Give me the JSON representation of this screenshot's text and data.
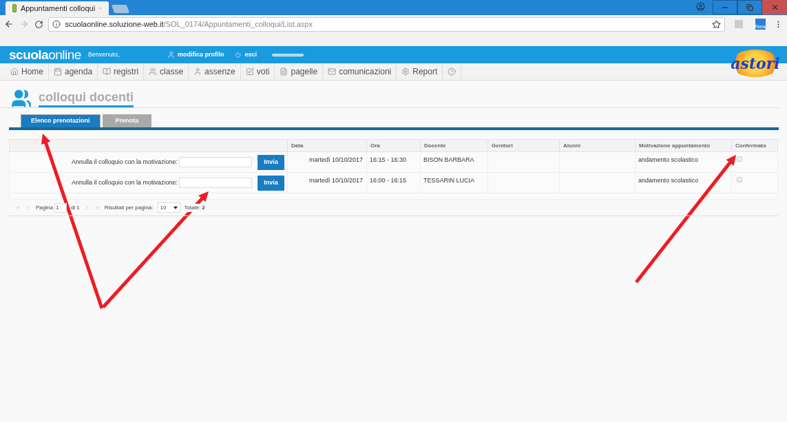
{
  "browser": {
    "tab_title": "Appuntamenti colloqui",
    "url_domain": "scuolaonline.soluzione-web.it",
    "url_path": "/SOL_0174/Appuntamenti_colloqui/List.aspx",
    "extension_badge": "New"
  },
  "header": {
    "brand_bold": "scuola",
    "brand_light": "online",
    "welcome": "Benvenuto,",
    "profile_link": "modifica profilo",
    "logout_link": "esci",
    "partner_logo": "astori"
  },
  "nav": [
    {
      "label": "Home"
    },
    {
      "label": "agenda"
    },
    {
      "label": "registri"
    },
    {
      "label": "classe"
    },
    {
      "label": "assenze"
    },
    {
      "label": "voti"
    },
    {
      "label": "pagelle"
    },
    {
      "label": "comunicazioni"
    },
    {
      "label": "Report"
    }
  ],
  "page_title": "colloqui docenti",
  "tabs": [
    {
      "label": "Elenco prenotazioni",
      "selected": true
    },
    {
      "label": "Prenota",
      "selected": false
    }
  ],
  "table": {
    "columns": [
      "",
      "Data",
      "Ora",
      "Docente",
      "Genitori",
      "Alunni",
      "Motivazione appuntamento",
      "Confermato"
    ],
    "rows": [
      {
        "cancel_label": "Annulla il colloquio con la motivazione:",
        "send_button": "Invia",
        "date": "martedì 10/10/2017",
        "time": "16:15 - 16:30",
        "teacher": "BISON BARBARA",
        "reason": "andamento scolastico",
        "confirmed": false
      },
      {
        "cancel_label": "Annulla il colloquio con la motivazione:",
        "send_button": "Invia",
        "date": "martedì 10/10/2017",
        "time": "16:00 - 16:15",
        "teacher": "TESSARIN LUCIA",
        "reason": "andamento scolastico",
        "confirmed": false
      }
    ]
  },
  "pager": {
    "page_label": "Pagina",
    "page": "1",
    "of_pages": "di 1",
    "per_page_label": "Risultati per pagina:",
    "per_page": "10",
    "total_label": "Totale:",
    "total": "2"
  }
}
